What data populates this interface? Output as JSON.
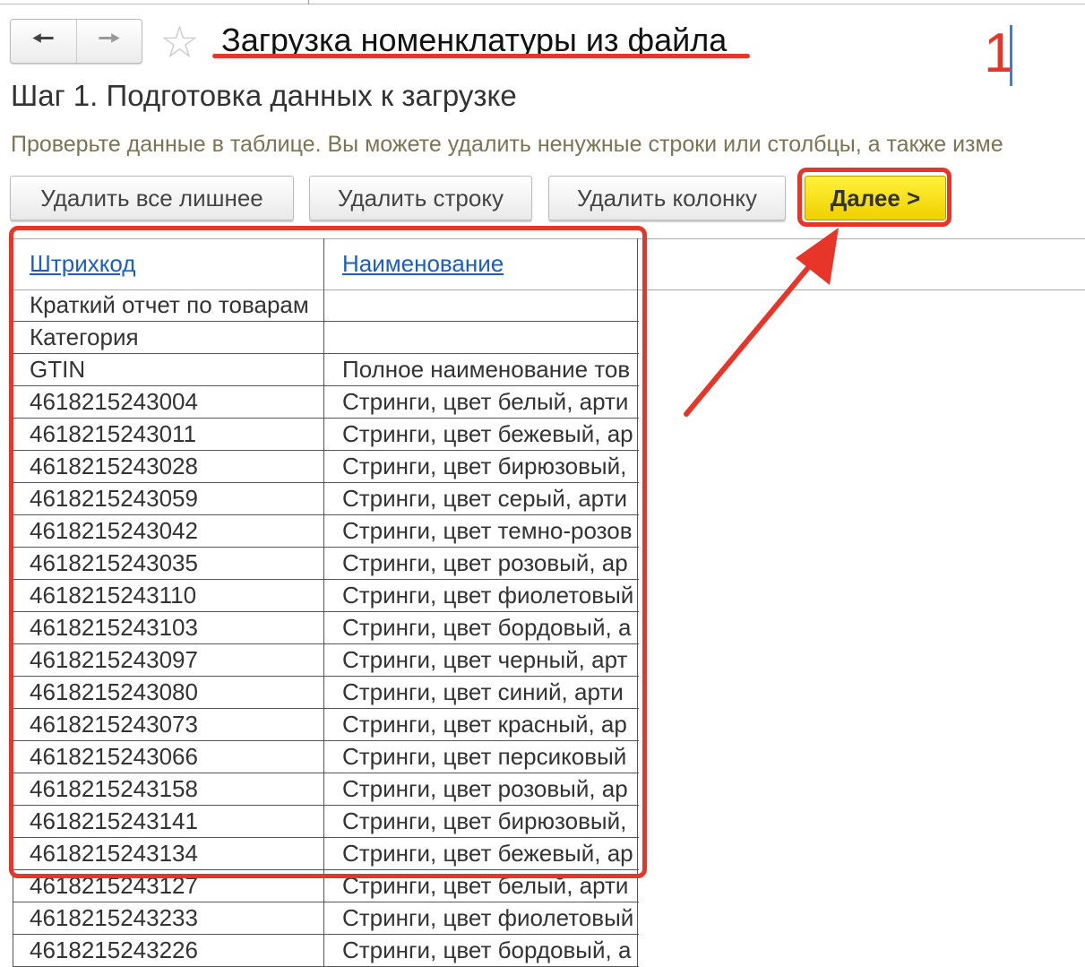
{
  "header": {
    "back_icon": "arrow-left",
    "forward_icon": "arrow-right",
    "favorite_icon": "star",
    "title": "Загрузка номенклатуры из файла",
    "annotation_number": "1"
  },
  "step_title": "Шаг 1. Подготовка данных к загрузке",
  "hint": "Проверьте данные в таблице. Вы можете удалить ненужные строки или столбцы, а также изме",
  "toolbar": {
    "delete_extra": "Удалить все лишнее",
    "delete_row": "Удалить строку",
    "delete_column": "Удалить колонку",
    "next": "Далее >"
  },
  "table": {
    "columns": [
      "Штрихкод",
      "Наименование"
    ],
    "rows": [
      [
        "Краткий отчет по товарам",
        ""
      ],
      [
        "Категория",
        ""
      ],
      [
        "GTIN",
        "Полное наименование тов"
      ],
      [
        "4618215243004",
        "Стринги, цвет белый, арти"
      ],
      [
        "4618215243011",
        "Стринги, цвет бежевый, ар"
      ],
      [
        "4618215243028",
        "Стринги, цвет бирюзовый,"
      ],
      [
        "4618215243059",
        "Стринги, цвет серый, арти"
      ],
      [
        "4618215243042",
        "Стринги, цвет темно-розов"
      ],
      [
        "4618215243035",
        "Стринги, цвет розовый, ар"
      ],
      [
        "4618215243110",
        "Стринги, цвет фиолетовый"
      ],
      [
        "4618215243103",
        "Стринги, цвет бордовый, а"
      ],
      [
        "4618215243097",
        "Стринги, цвет черный, арт"
      ],
      [
        "4618215243080",
        "Стринги, цвет синий, арти"
      ],
      [
        "4618215243073",
        "Стринги, цвет красный, ар"
      ],
      [
        "4618215243066",
        "Стринги, цвет персиковый"
      ],
      [
        "4618215243158",
        "Стринги, цвет розовый, ар"
      ],
      [
        "4618215243141",
        "Стринги, цвет бирюзовый,"
      ],
      [
        "4618215243134",
        "Стринги, цвет бежевый, ар"
      ],
      [
        "4618215243127",
        "Стринги, цвет белый, арти"
      ],
      [
        "4618215243233",
        "Стринги, цвет фиолетовый"
      ],
      [
        "4618215243226",
        "Стринги, цвет бордовый, а"
      ]
    ]
  },
  "colors": {
    "annotation": "#e8352a",
    "next_button": "#f5dc00",
    "link": "#1a5fc8",
    "hint": "#7b7455"
  }
}
